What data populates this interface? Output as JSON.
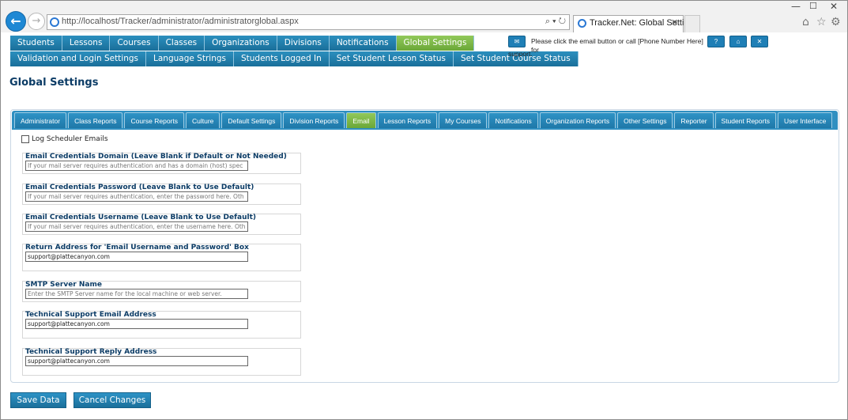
{
  "browser": {
    "url": "http://localhost/Tracker/administrator/administratorglobal.aspx",
    "tab_title": "Tracker.Net: Global Settings",
    "address_tools": "⌕ ▾ ↻"
  },
  "menu": {
    "row1": [
      {
        "label": "Students"
      },
      {
        "label": "Lessons"
      },
      {
        "label": "Courses"
      },
      {
        "label": "Classes"
      },
      {
        "label": "Organizations"
      },
      {
        "label": "Divisions"
      },
      {
        "label": "Notifications"
      },
      {
        "label": "Global Settings",
        "active": true
      }
    ],
    "row2": [
      {
        "label": "Validation and Login Settings"
      },
      {
        "label": "Language Strings"
      },
      {
        "label": "Students Logged In"
      },
      {
        "label": "Set Student Lesson Status"
      },
      {
        "label": "Set Student Course Status"
      }
    ]
  },
  "help": {
    "text": "Please click the email button or call [Phone Number Here] for",
    "text2": "support.",
    "help_label": "?",
    "home_label": "⌂",
    "close_label": "✕",
    "email_label": "✉"
  },
  "page_title": "Global Settings",
  "settings_tabs": [
    {
      "label": "Administrator"
    },
    {
      "label": "Class Reports"
    },
    {
      "label": "Course Reports"
    },
    {
      "label": "Culture"
    },
    {
      "label": "Default Settings"
    },
    {
      "label": "Division Reports"
    },
    {
      "label": "Email",
      "active": true
    },
    {
      "label": "Lesson Reports"
    },
    {
      "label": "My Courses"
    },
    {
      "label": "Notifications"
    },
    {
      "label": "Organization Reports"
    },
    {
      "label": "Other Settings"
    },
    {
      "label": "Reporter"
    },
    {
      "label": "Student Reports"
    },
    {
      "label": "User Interface"
    }
  ],
  "log_scheduler": {
    "label": "Log Scheduler Emails",
    "checked": false
  },
  "fields": [
    {
      "label": "Email Credentials Domain (Leave Blank if Default or Not Needed)",
      "value": "",
      "placeholder": "If your mail server requires authentication and has a domain (host) spec"
    },
    {
      "label": "Email Credentials Password (Leave Blank to Use Default)",
      "value": "",
      "placeholder": "If your mail server requires authentication, enter the password here. Oth"
    },
    {
      "label": "Email Credentials Username (Leave Blank to Use Default)",
      "value": "",
      "placeholder": "If your mail server requires authentication, enter the username here. Oth"
    },
    {
      "label": "Return Address for 'Email Username and Password' Box",
      "value": "support@plattecanyon.com",
      "placeholder": ""
    },
    {
      "label": "SMTP Server Name",
      "value": "",
      "placeholder": "Enter the SMTP Server name for the local machine or web server."
    },
    {
      "label": "Technical Support Email Address",
      "value": "support@plattecanyon.com",
      "placeholder": ""
    },
    {
      "label": "Technical Support Reply Address",
      "value": "support@plattecanyon.com",
      "placeholder": ""
    }
  ],
  "actions": {
    "save_label": "Save Data",
    "cancel_label": "Cancel Changes"
  },
  "colors": {
    "menu_blue": "#1f7fb6",
    "menu_active_green": "#7ab546",
    "title_navy": "#0c3c66"
  }
}
